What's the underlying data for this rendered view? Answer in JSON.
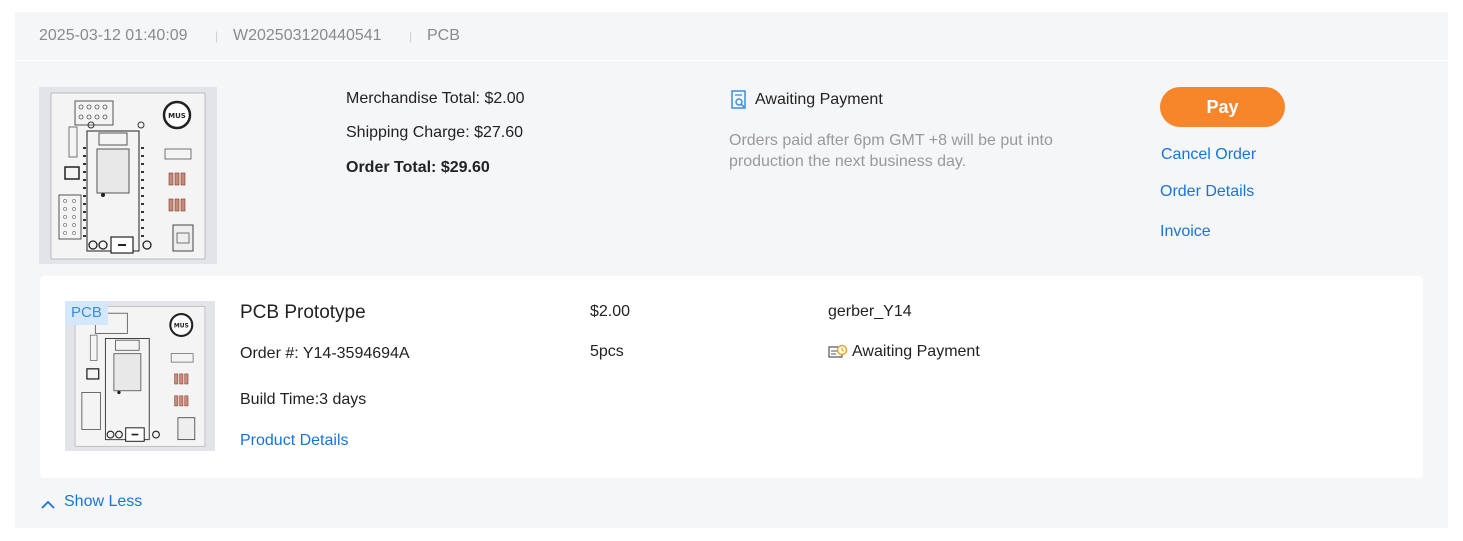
{
  "order": {
    "datetime": "2025-03-12 01:40:09",
    "order_id": "W202503120440541",
    "category": "PCB",
    "separator": "|"
  },
  "summary": {
    "merchandise_total": "Merchandise Total: $2.00",
    "shipping_charge": "Shipping Charge: $27.60",
    "order_total": "Order Total: $29.60"
  },
  "status": {
    "label": "Awaiting Payment",
    "icon": "document-search-icon",
    "note": "Orders paid after 6pm GMT +8 will be put into production the next business day."
  },
  "actions": {
    "pay": "Pay",
    "cancel": "Cancel Order",
    "details": "Order Details",
    "invoice": "Invoice"
  },
  "item": {
    "tag": "PCB",
    "title": "PCB Prototype",
    "order_number": "Order #: Y14-3594694A",
    "build_time": "Build Time:3 days",
    "product_details": "Product Details",
    "price": "$2.00",
    "quantity": "5pcs",
    "file_name": "gerber_Y14",
    "status": "Awaiting Payment",
    "status_icon": "payment-clock-icon"
  },
  "footer": {
    "toggle": "Show Less",
    "toggle_icon": "chevron-up-icon"
  },
  "colors": {
    "accent": "#f7852a",
    "link": "#1a73d9",
    "card_bg": "#f5f6f8",
    "status_icon_orange": "#f0a020"
  }
}
